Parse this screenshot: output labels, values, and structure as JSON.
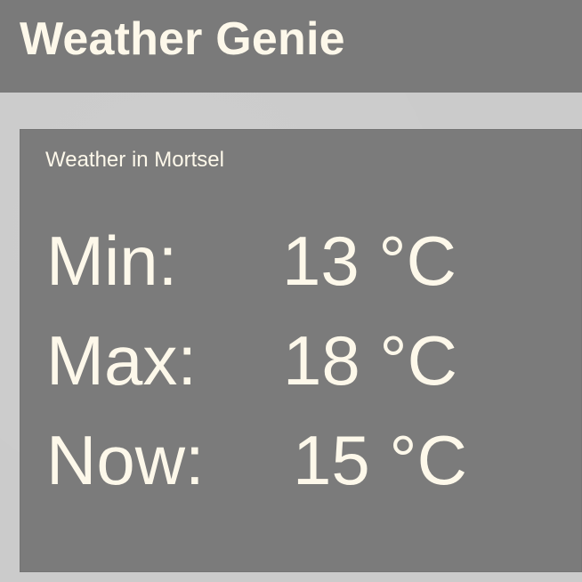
{
  "header": {
    "title": "Weather Genie"
  },
  "weather": {
    "subtitle": "Weather in Mortsel",
    "rows": [
      {
        "label": "Min:",
        "value": "13 °C"
      },
      {
        "label": "Max:",
        "value": "18 °C"
      },
      {
        "label": "Now:",
        "value": "15 °C"
      }
    ]
  },
  "colors": {
    "header_bg": "#7a7a7a",
    "card_bg": "#7b7b7b",
    "page_bg": "#cbcbcb",
    "text": "#fdf8ea"
  }
}
